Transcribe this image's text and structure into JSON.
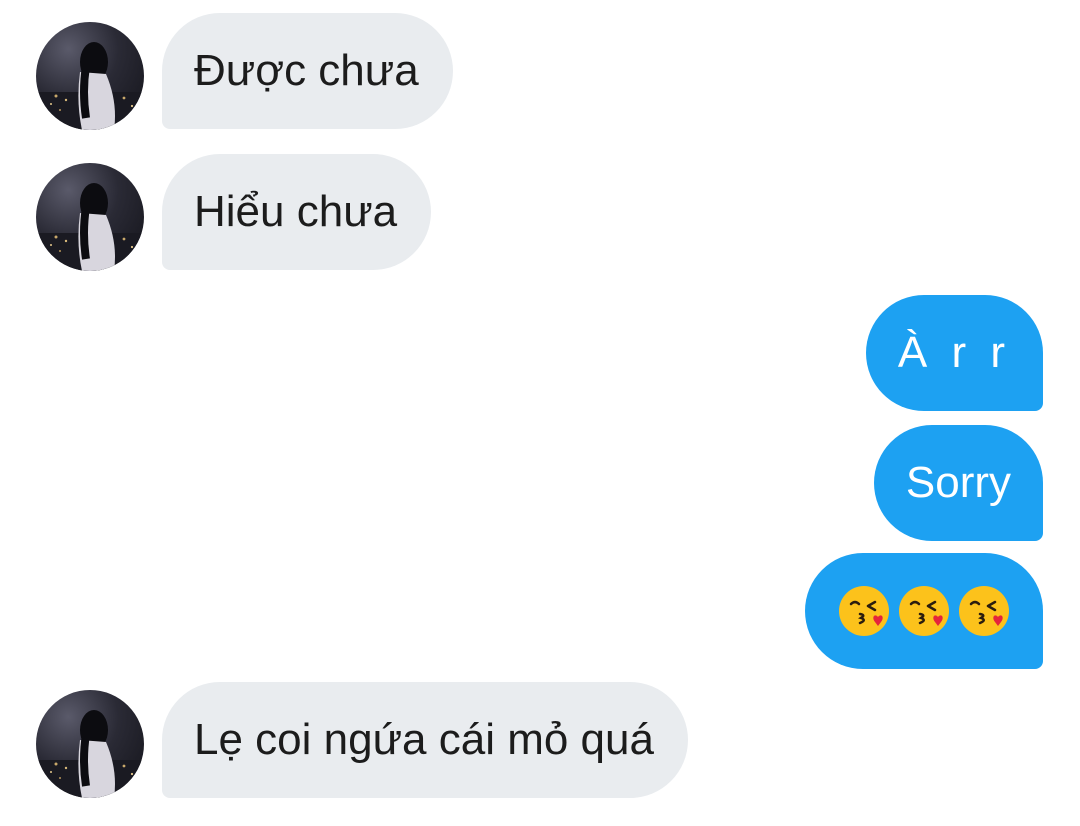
{
  "messages": [
    {
      "sender": "other",
      "text": "Được chưa"
    },
    {
      "sender": "other",
      "text": "Hiểu chưa"
    },
    {
      "sender": "me",
      "text": "À r r"
    },
    {
      "sender": "me",
      "text": "Sorry"
    },
    {
      "sender": "me",
      "emoji": [
        "face-blowing-a-kiss",
        "face-blowing-a-kiss",
        "face-blowing-a-kiss"
      ]
    },
    {
      "sender": "other",
      "text": "Lẹ coi ngứa cái mỏ quá"
    }
  ],
  "colors": {
    "incoming_bubble": "#e9ecef",
    "outgoing_bubble": "#1da1f2",
    "incoming_text": "#1c1c1c",
    "outgoing_text": "#ffffff"
  }
}
